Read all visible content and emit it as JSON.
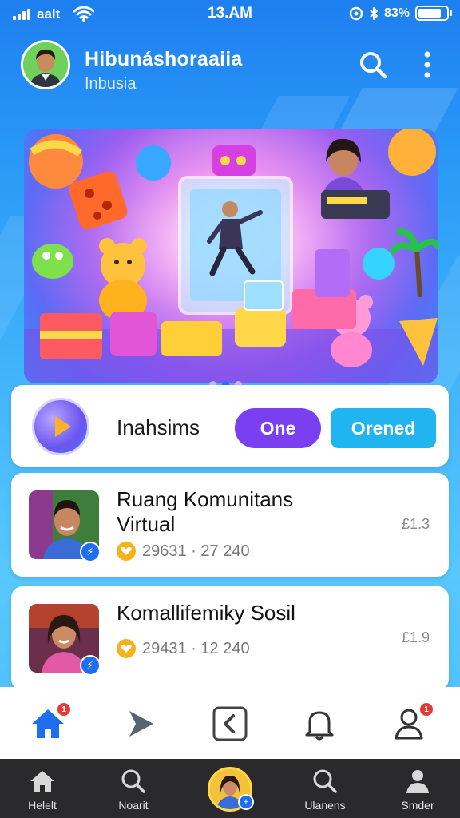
{
  "status_bar": {
    "carrier": "aalt",
    "time": "13.AM",
    "battery_text": "83%",
    "battery_level": 0.83,
    "icons": [
      "signal-icon",
      "wifi-icon",
      "alarm-icon",
      "bluetooth-icon",
      "battery-icon"
    ]
  },
  "header": {
    "title": "Hibunáshoraaiia",
    "subtitle": "Inbusia",
    "avatar": "profile-avatar",
    "actions": [
      "search-icon",
      "more-vertical-icon"
    ]
  },
  "banner": {
    "image": "virtual-community-game-banner",
    "carousel_pages": 3,
    "active_page": 2
  },
  "filter": {
    "label": "Inahsims",
    "option_one": "One",
    "option_opened": "Orened",
    "accent_one": "#7b3ff2",
    "accent_opened": "#20b4f0"
  },
  "list": {
    "items": [
      {
        "title": "Ruang Komunitans Virtual",
        "meta": "29631 · 27 240",
        "price": "£1.3",
        "badge_icon": "lightning-icon"
      },
      {
        "title": "Komallifemiky Sosil",
        "meta": "29431 · 12 240",
        "price": "£1.9",
        "badge_icon": "lightning-icon"
      }
    ]
  },
  "tab_bar": {
    "items": [
      {
        "icon": "home-icon",
        "badge": "1",
        "active": true
      },
      {
        "icon": "play-arrow-icon",
        "badge": "",
        "active": false
      },
      {
        "icon": "back-square-icon",
        "badge": "",
        "active": false
      },
      {
        "icon": "bell-icon",
        "badge": "",
        "active": false
      },
      {
        "icon": "user-icon",
        "badge": "1",
        "active": false
      }
    ],
    "active_color": "#1e6ff0"
  },
  "bottom_nav": {
    "items": [
      {
        "label": "Helelt",
        "icon": "home-icon"
      },
      {
        "label": "Noarit",
        "icon": "search-icon"
      },
      {
        "label": "",
        "icon": "profile-avatar"
      },
      {
        "label": "Ulanens",
        "icon": "search-icon"
      },
      {
        "label": "Smder",
        "icon": "user-icon"
      }
    ]
  }
}
